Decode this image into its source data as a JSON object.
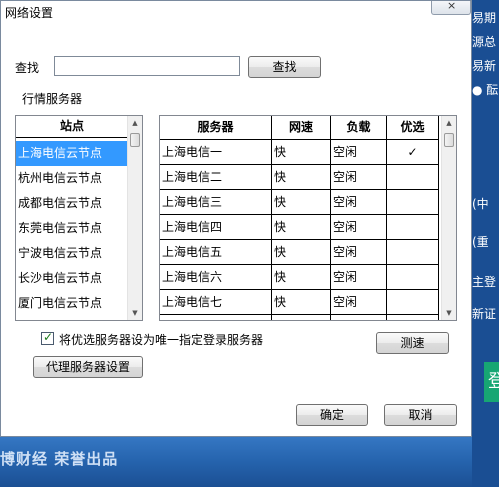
{
  "window": {
    "title": "网络设置"
  },
  "search": {
    "label": "查找",
    "value": "",
    "button_label": "查找"
  },
  "section_label": "行情服务器",
  "stations": {
    "header": "站点",
    "items": [
      "上海电信云节点",
      "杭州电信云节点",
      "成都电信云节点",
      "东莞电信云节点",
      "宁波电信云节点",
      "长沙电信云节点",
      "厦门电信云节点"
    ],
    "selected_index": 0
  },
  "servers": {
    "columns": [
      "服务器",
      "网速",
      "负载",
      "优选"
    ],
    "rows": [
      [
        "上海电信一",
        "快",
        "空闲",
        "✓"
      ],
      [
        "上海电信二",
        "快",
        "空闲",
        ""
      ],
      [
        "上海电信三",
        "快",
        "空闲",
        ""
      ],
      [
        "上海电信四",
        "快",
        "空闲",
        ""
      ],
      [
        "上海电信五",
        "快",
        "空闲",
        ""
      ],
      [
        "上海电信六",
        "快",
        "空闲",
        ""
      ],
      [
        "上海电信七",
        "快",
        "空闲",
        ""
      ]
    ]
  },
  "only_preferred": {
    "label": "将优选服务器设为唯一指定登录服务器",
    "checked": true
  },
  "buttons": {
    "speed_test": "测速",
    "proxy": "代理服务器设置",
    "ok": "确定",
    "cancel": "取消"
  },
  "background": {
    "side_texts": [
      "易期",
      "源总",
      "易新",
      "● 酝",
      "(中",
      "(重",
      "主登",
      "新证",
      "登"
    ],
    "brand": "博财经 荣誉出品"
  }
}
